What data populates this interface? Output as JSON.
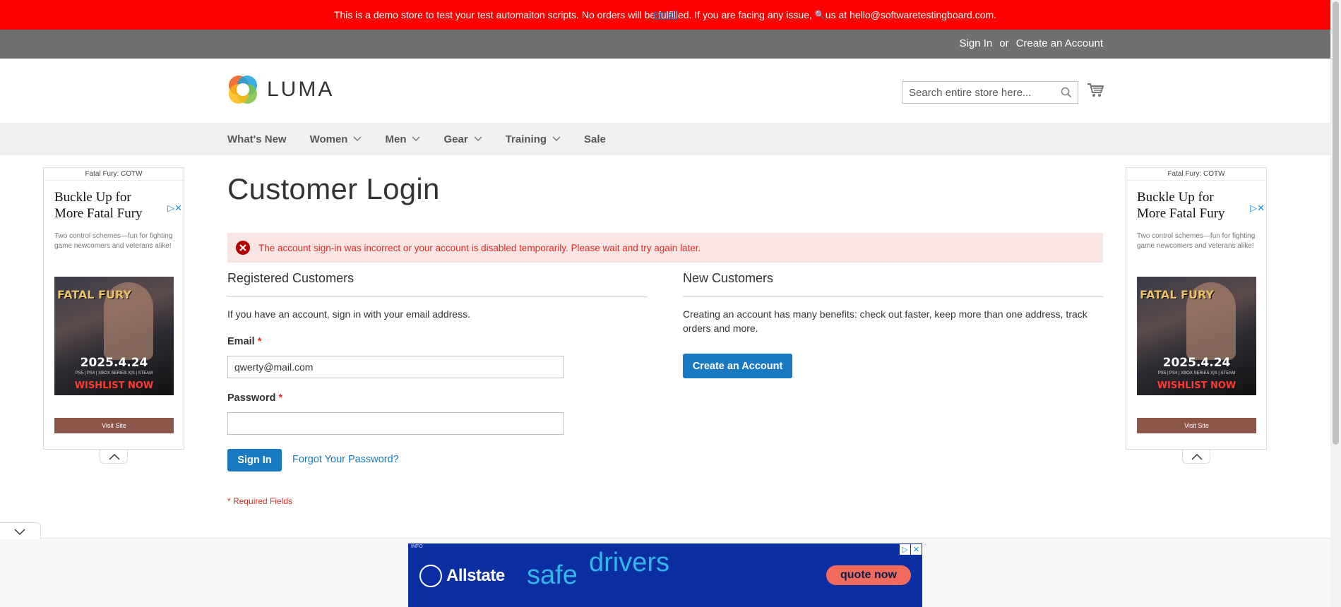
{
  "demo_banner": {
    "text_before": "This is a demo store to test your test automaiton scripts. No orders will be fulfilled. If you are facing any issue,",
    "link": "email",
    "text_after": "us at hello@softwaretestingboard.com."
  },
  "top_links": {
    "sign_in": "Sign In",
    "or": "or",
    "create_account": "Create an Account"
  },
  "logo": {
    "text": "LUMA"
  },
  "search": {
    "placeholder": "Search entire store here..."
  },
  "nav": {
    "items": [
      {
        "label": "What's New",
        "has_dropdown": false
      },
      {
        "label": "Women",
        "has_dropdown": true
      },
      {
        "label": "Men",
        "has_dropdown": true
      },
      {
        "label": "Gear",
        "has_dropdown": true
      },
      {
        "label": "Training",
        "has_dropdown": true
      },
      {
        "label": "Sale",
        "has_dropdown": false
      }
    ]
  },
  "page": {
    "title": "Customer Login",
    "error": "The account sign-in was incorrect or your account is disabled temporarily. Please wait and try again later."
  },
  "registered": {
    "title": "Registered Customers",
    "intro": "If you have an account, sign in with your email address.",
    "email_label": "Email",
    "email_value": "qwerty@mail.com",
    "password_label": "Password",
    "password_value": "",
    "required_mark": "*",
    "sign_in_button": "Sign In",
    "forgot_link": "Forgot Your Password?",
    "required_note": "* Required Fields"
  },
  "new_customers": {
    "title": "New Customers",
    "text": "Creating an account has many benefits: check out faster, keep more than one address, track orders and more.",
    "button": "Create an Account"
  },
  "side_ad": {
    "header": "Fatal Fury: COTW",
    "title": "Buckle Up for More Fatal Fury",
    "description": "Two control schemes—fun for fighting game newcomers and veterans alike!",
    "image_logo": "FATAL FURY",
    "image_date": "2025.4.24",
    "image_platforms": "PS5 | PS4 | XBOX SERIES X|S | STEAM",
    "image_cta": "WISHLIST NOW",
    "button": "Visit Site"
  },
  "bottom_ad": {
    "info": "INFO",
    "brand": "Allstate",
    "word1": "safe",
    "word2": "drivers",
    "cta": "quote now"
  },
  "colors": {
    "banner_red": "#ff0000",
    "top_bar": "#6e716e",
    "primary_blue": "#1979c3",
    "error_text": "#e02b27",
    "error_bg": "#fae5e5",
    "nav_bg": "#f0f0f0"
  }
}
